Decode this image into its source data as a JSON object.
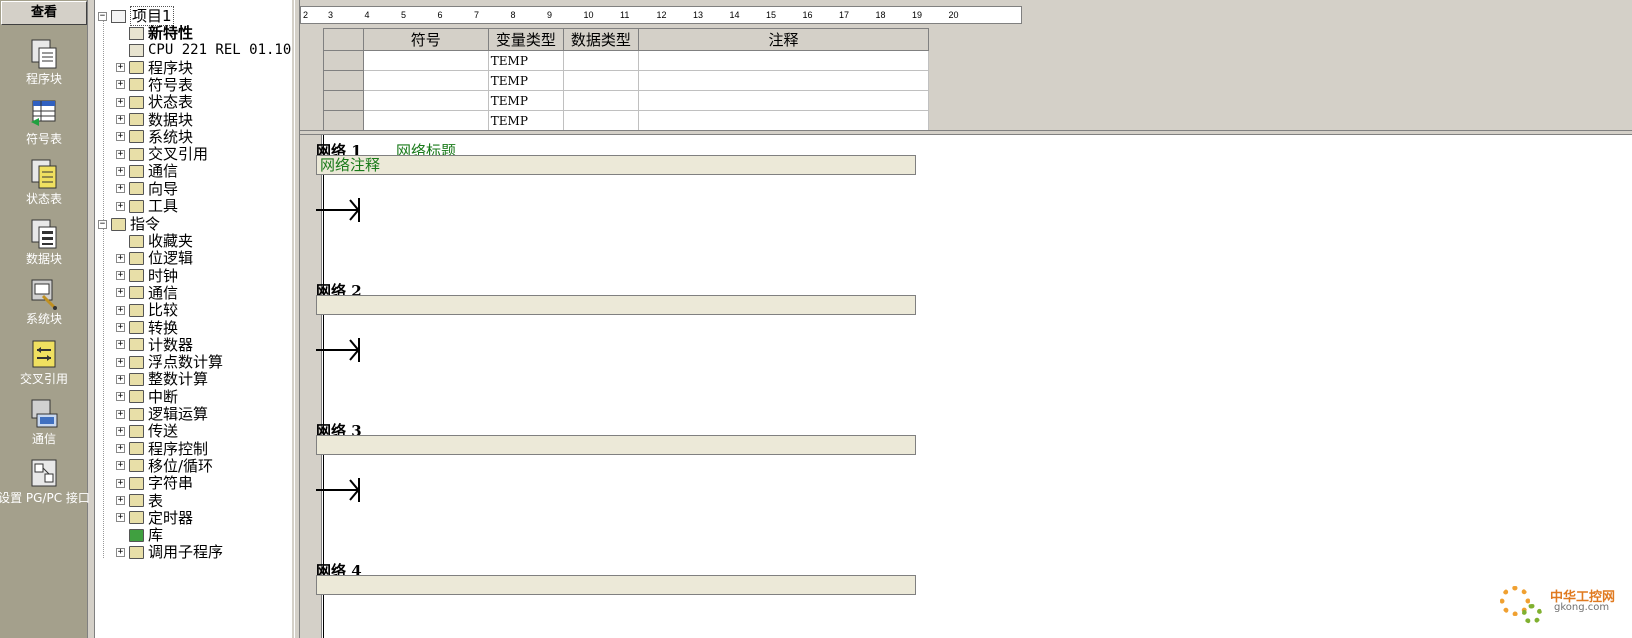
{
  "viewbar": {
    "header": "查看",
    "items": [
      {
        "label": "程序块",
        "icon": "program-block-icon"
      },
      {
        "label": "符号表",
        "icon": "symbol-table-icon"
      },
      {
        "label": "状态表",
        "icon": "status-table-icon"
      },
      {
        "label": "数据块",
        "icon": "data-block-icon"
      },
      {
        "label": "系统块",
        "icon": "system-block-icon"
      },
      {
        "label": "交叉引用",
        "icon": "cross-reference-icon"
      },
      {
        "label": "通信",
        "icon": "communication-icon"
      },
      {
        "label": "设置 PG/PC 接口",
        "icon": "set-pgpc-interface-icon"
      }
    ]
  },
  "tree": {
    "root": "项目1",
    "project_items": [
      "新特性",
      "CPU 221 REL 01.10",
      "程序块",
      "符号表",
      "状态表",
      "数据块",
      "系统块",
      "交叉引用",
      "通信",
      "向导",
      "工具"
    ],
    "instructions_label": "指令",
    "instruction_items": [
      "收藏夹",
      "位逻辑",
      "时钟",
      "通信",
      "比较",
      "转换",
      "计数器",
      "浮点数计算",
      "整数计算",
      "中断",
      "逻辑运算",
      "传送",
      "程序控制",
      "移位/循环",
      "字符串",
      "表",
      "定时器",
      "库",
      "调用子程序"
    ]
  },
  "ruler": {
    "start_label": "2",
    "labels": [
      "3",
      "4",
      "5",
      "6",
      "7",
      "8",
      "9",
      "10",
      "11",
      "12",
      "13",
      "14",
      "15",
      "16",
      "17",
      "18",
      "19",
      "20"
    ]
  },
  "variable_table": {
    "headers": [
      "符号",
      "变量类型",
      "数据类型",
      "注释"
    ],
    "rows": [
      [
        "",
        "TEMP",
        "",
        ""
      ],
      [
        "",
        "TEMP",
        "",
        ""
      ],
      [
        "",
        "TEMP",
        "",
        ""
      ],
      [
        "",
        "TEMP",
        "",
        ""
      ]
    ]
  },
  "networks": [
    {
      "title": "网络 1",
      "subtitle": "网络标题",
      "comment": "网络注释"
    },
    {
      "title": "网络 2",
      "subtitle": "",
      "comment": ""
    },
    {
      "title": "网络 3",
      "subtitle": "",
      "comment": ""
    },
    {
      "title": "网络 4",
      "subtitle": "",
      "comment": ""
    }
  ],
  "watermark": {
    "text": "中华工控网",
    "sub": "gkong.com"
  }
}
